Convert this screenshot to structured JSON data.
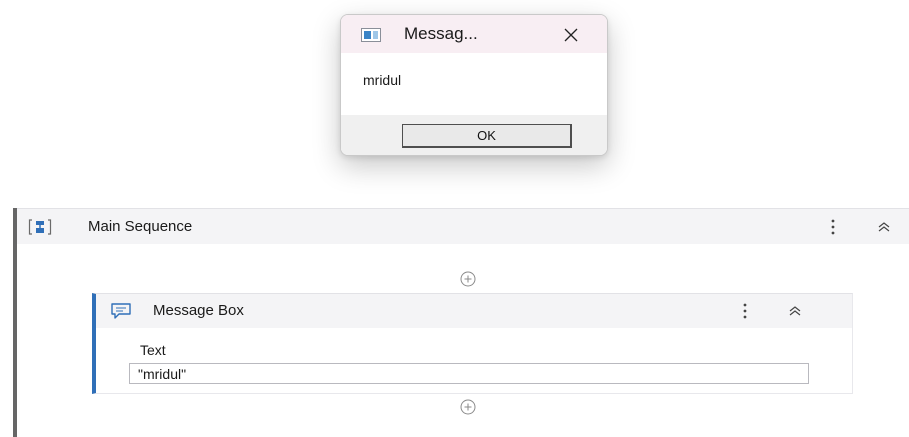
{
  "dialog": {
    "title": "Messag...",
    "message": "mridul",
    "ok_label": "OK"
  },
  "sequence": {
    "title": "Main Sequence"
  },
  "activity": {
    "title": "Message Box",
    "field_label": "Text",
    "field_value": "\"mridul\""
  },
  "icons": {
    "dialog_app": "window-app-icon",
    "dialog_close": "close-icon",
    "sequence": "sequence-icon",
    "activity": "message-box-icon",
    "menu": "vertical-ellipsis-icon",
    "collapse": "chevron-double-up-icon",
    "add": "add-activity-icon"
  },
  "colors": {
    "dialog_titlebar": "#f8eef3",
    "header_background": "#f4f4f6",
    "activity_accent": "#2f6fb8",
    "sequence_accent": "#666666"
  }
}
